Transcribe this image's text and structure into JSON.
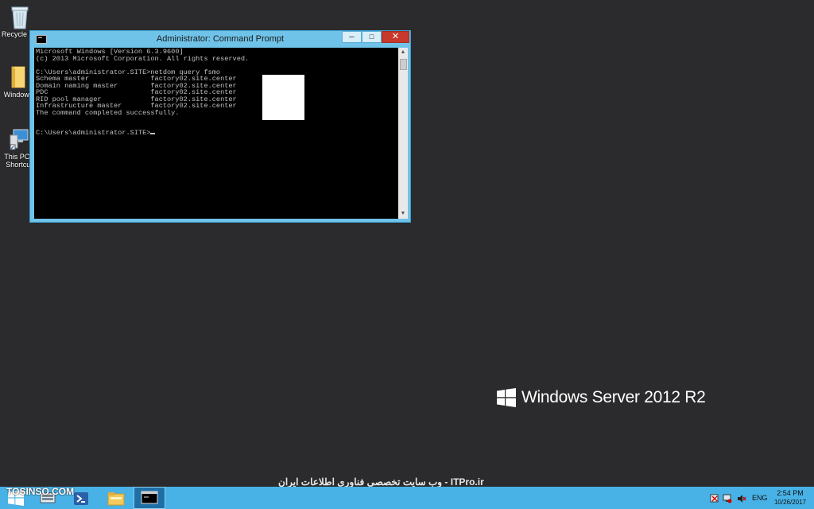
{
  "desktop": {
    "icons": [
      {
        "label": "Recycle Bin"
      },
      {
        "label": "Windows"
      },
      {
        "label": "This PC - Shortcut"
      }
    ]
  },
  "cmd": {
    "title": "Administrator: Command Prompt",
    "lines": [
      "Microsoft Windows [Version 6.3.9600]",
      "(c) 2013 Microsoft Corporation. All rights reserved.",
      "",
      "C:\\Users\\administrator.SITE>netdom query fsmo",
      "Schema master               factory02.site.center         ir",
      "Domain naming master        factory02.site.center         ir",
      "PDC                         factory02.site.center         ir",
      "RID pool manager            factory02.site.center         ir",
      "Infrastructure master       factory02.site.center         ir",
      "The command completed successfully.",
      "",
      ""
    ],
    "prompt": "C:\\Users\\administrator.SITE>"
  },
  "branding": {
    "text": "Windows Server 2012 R2"
  },
  "watermark": {
    "text": "وب سایت تخصصی فناوری اطلاعات ایران - ITPro.ir",
    "tosinso": "TOSINSO.COM"
  },
  "taskbar": {
    "lang": "ENG",
    "time": "2:54 PM",
    "date": "10/26/2017"
  },
  "colors": {
    "desktop": "#2b2b2d",
    "window_frame": "#6fc3e8",
    "taskbar": "#48b2e6",
    "close_button": "#c7392c"
  }
}
